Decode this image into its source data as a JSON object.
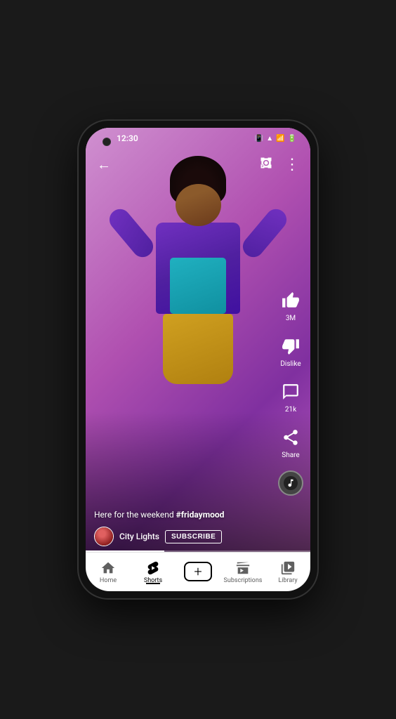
{
  "device": {
    "status_bar": {
      "time": "12:30"
    }
  },
  "top_bar": {
    "back_label": "←",
    "camera_label": "📷",
    "more_label": "⋮"
  },
  "video": {
    "caption": "Here for the weekend ",
    "hashtag": "#fridaymood",
    "channel_name": "City Lights",
    "subscribe_label": "SUBSCRIBE"
  },
  "actions": {
    "like_count": "3M",
    "dislike_label": "Dislike",
    "comments_count": "21k",
    "share_label": "Share"
  },
  "bottom_nav": {
    "items": [
      {
        "label": "Home",
        "icon": "home",
        "active": false
      },
      {
        "label": "Shorts",
        "icon": "shorts",
        "active": true
      },
      {
        "label": "",
        "icon": "add",
        "active": false
      },
      {
        "label": "Subscriptions",
        "icon": "subscriptions",
        "active": false
      },
      {
        "label": "Library",
        "icon": "library",
        "active": false
      }
    ]
  }
}
